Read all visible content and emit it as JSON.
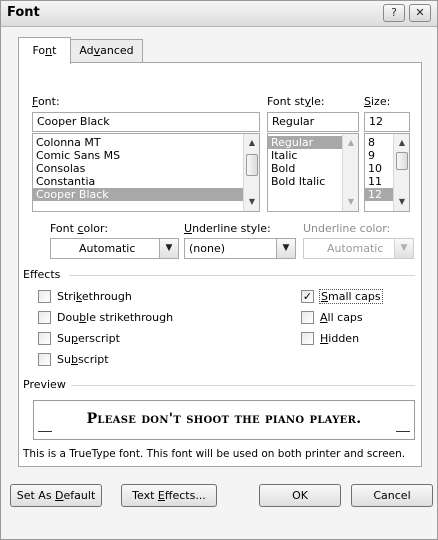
{
  "window": {
    "title": "Font",
    "help_glyph": "?",
    "close_glyph": "✕"
  },
  "tabs": [
    {
      "pre": "Fo",
      "acc": "n",
      "post": "t",
      "active": true
    },
    {
      "pre": "Ad",
      "acc": "v",
      "post": "anced",
      "active": false
    }
  ],
  "font": {
    "label_acc": "F",
    "label_rest": "ont:",
    "value": "Cooper Black",
    "items": [
      "Colonna MT",
      "Comic Sans MS",
      "Consolas",
      "Constantia",
      "Cooper Black"
    ],
    "selected": "Cooper Black"
  },
  "style": {
    "label_pre": "Font st",
    "label_acc": "y",
    "label_post": "le:",
    "value": "Regular",
    "items": [
      "Regular",
      "Italic",
      "Bold",
      "Bold Italic"
    ],
    "selected": "Regular"
  },
  "size": {
    "label_acc": "S",
    "label_rest": "ize:",
    "value": "12",
    "items": [
      "8",
      "9",
      "10",
      "11",
      "12"
    ],
    "selected": "12"
  },
  "font_color": {
    "label_pre": "Font ",
    "label_acc": "c",
    "label_post": "olor:",
    "value": "Automatic"
  },
  "underline_style": {
    "label_acc": "U",
    "label_rest": "nderline style:",
    "value": "(none)"
  },
  "underline_color": {
    "label": "Underline color:",
    "value": "Automatic"
  },
  "effects": {
    "title": "Effects",
    "strikethrough": {
      "pre": "Stri",
      "acc": "k",
      "post": "ethrough",
      "checked": false
    },
    "double_strikethrough": {
      "pre": "Dou",
      "acc": "b",
      "post": "le strikethrough",
      "checked": false
    },
    "superscript": {
      "pre": "Su",
      "acc": "p",
      "post": "erscript",
      "checked": false
    },
    "subscript": {
      "pre": "Su",
      "acc": "b",
      "post": "script",
      "checked": false
    },
    "small_caps": {
      "pre": "",
      "acc": "S",
      "post": "mall caps",
      "checked": true
    },
    "all_caps": {
      "pre": "",
      "acc": "A",
      "post": "ll caps",
      "checked": false
    },
    "hidden": {
      "pre": "",
      "acc": "H",
      "post": "idden",
      "checked": false
    }
  },
  "preview": {
    "title": "Preview",
    "sample": "Please don't shoot the piano player.",
    "note": "This is a TrueType font. This font will be used on both printer and screen."
  },
  "buttons": {
    "set_default": {
      "pre": "Set As ",
      "acc": "D",
      "post": "efault"
    },
    "text_effects": {
      "pre": "Text ",
      "acc": "E",
      "post": "ffects..."
    },
    "ok": "OK",
    "cancel": "Cancel"
  },
  "icons": {
    "dropdown": "▼",
    "scroll_up": "▲",
    "scroll_down": "▼",
    "check": "✓"
  }
}
